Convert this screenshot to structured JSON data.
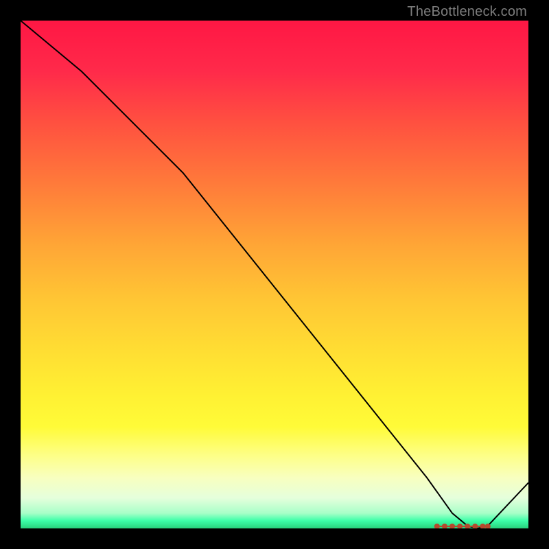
{
  "watermark": "TheBottleneck.com",
  "chart_data": {
    "type": "line",
    "title": "",
    "xlabel": "",
    "ylabel": "",
    "xlim": [
      0,
      100
    ],
    "ylim": [
      0,
      100
    ],
    "grid": false,
    "series": [
      {
        "name": "curve",
        "x": [
          0,
          12,
          24,
          32,
          40,
          50,
          60,
          70,
          80,
          85,
          88,
          90,
          92,
          100
        ],
        "y": [
          100,
          90,
          78,
          70,
          60,
          47.5,
          35,
          22.5,
          10,
          3,
          0.5,
          0,
          0.5,
          9
        ],
        "stroke": "#000000",
        "width": 2
      }
    ],
    "markers": {
      "name": "optimal-band",
      "color": "#b5492e",
      "xrange": [
        82,
        92
      ],
      "y": 0.4,
      "dots_x": [
        82,
        83.5,
        85,
        86.5,
        88,
        89.5,
        91,
        92
      ]
    }
  }
}
